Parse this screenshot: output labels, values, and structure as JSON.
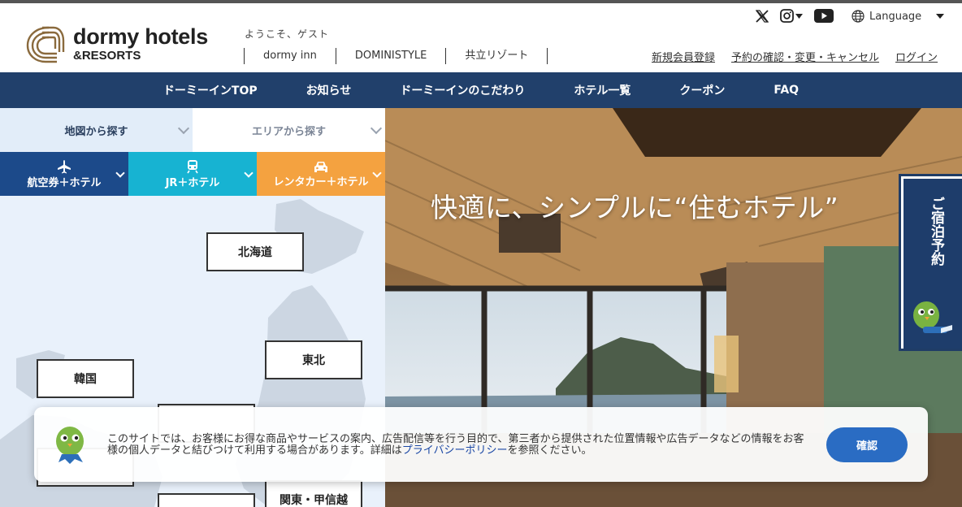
{
  "header": {
    "logo_line1": "dormy hotels",
    "logo_line2": "&RESORTS",
    "welcome": "ようこそ、ゲスト",
    "brand_links": [
      "dormy inn",
      "DOMINISTYLE",
      "共立リゾート"
    ],
    "language_label": "Language",
    "account_links": [
      "新規会員登録",
      "予約の確認・変更・キャンセル",
      "ログイン"
    ],
    "social_icons": [
      "x-icon",
      "instagram-icon",
      "youtube-icon"
    ]
  },
  "nav": {
    "items": [
      "ドーミーインTOP",
      "お知らせ",
      "ドーミーインのこだわり",
      "ホテル一覧",
      "クーポン",
      "FAQ"
    ]
  },
  "search": {
    "tabs": [
      "地図から探す",
      "エリアから探す"
    ],
    "active_tab": "地図から探す",
    "plans": [
      {
        "label": "航空券＋ホテル",
        "icon": "airplane-icon",
        "color": "#1c4a8a"
      },
      {
        "label": "JR＋ホテル",
        "icon": "train-icon",
        "color": "#17b3d2"
      },
      {
        "label": "レンタカー＋ホテル",
        "icon": "car-icon",
        "color": "#f4a240"
      }
    ],
    "regions": [
      "北海道",
      "東北",
      "韓国",
      "関東・甲信越"
    ]
  },
  "hero": {
    "title": "快適に、シンプルに“住むホテル”"
  },
  "reserve_tab": {
    "label": "ご宿泊予約"
  },
  "cookie": {
    "text_before": "このサイトでは、お客様にお得な商品やサービスの案内、広告配信等を行う目的で、第三者から提供された位置情報や広告データなどの情報をお客様の個人データと結びつけて利用する場合があります。詳細は",
    "link": "プライバシーポリシー",
    "text_after": "を参照ください。",
    "button": "確認"
  },
  "colors": {
    "nav_bg": "#21406b",
    "map_bg": "#e9f1fb",
    "accent_button": "#2a6cc3"
  }
}
